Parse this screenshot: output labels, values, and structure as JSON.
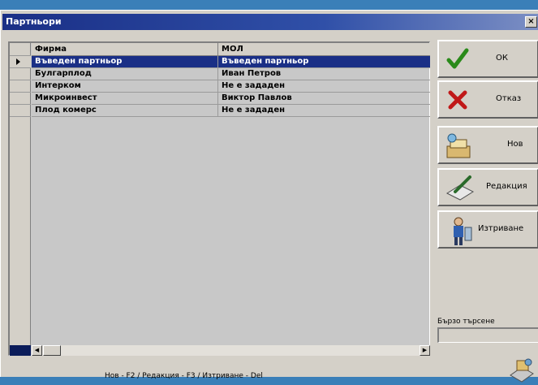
{
  "window": {
    "title": "Партньори",
    "close_label": "×"
  },
  "grid": {
    "columns": [
      "Фирма",
      "МОЛ"
    ],
    "rows": [
      {
        "firm": "Въведен партньор",
        "mol": "Въведен партньор",
        "selected": true
      },
      {
        "firm": "Булгарплод",
        "mol": "Иван Петров"
      },
      {
        "firm": "Интерком",
        "mol": "Не е зададен"
      },
      {
        "firm": "Микроинвест",
        "mol": "Виктор Павлов"
      },
      {
        "firm": "Плод комерс",
        "mol": "Не е зададен"
      }
    ]
  },
  "buttons": {
    "ok": "ОК",
    "cancel": "Отказ",
    "new": "Нов",
    "edit": "Редакция",
    "delete": "Изтриване"
  },
  "search": {
    "label": "Бързо търсене",
    "value": ""
  },
  "status": {
    "hint": "Нов - F2 / Редакция - F3 / Изтриване - Del"
  },
  "colors": {
    "title_bar": "#1a2f86",
    "selection": "#1a2f86",
    "window_bg": "#d4d0c8",
    "ok_check": "#2a8a1a",
    "cancel_x": "#c01818"
  }
}
